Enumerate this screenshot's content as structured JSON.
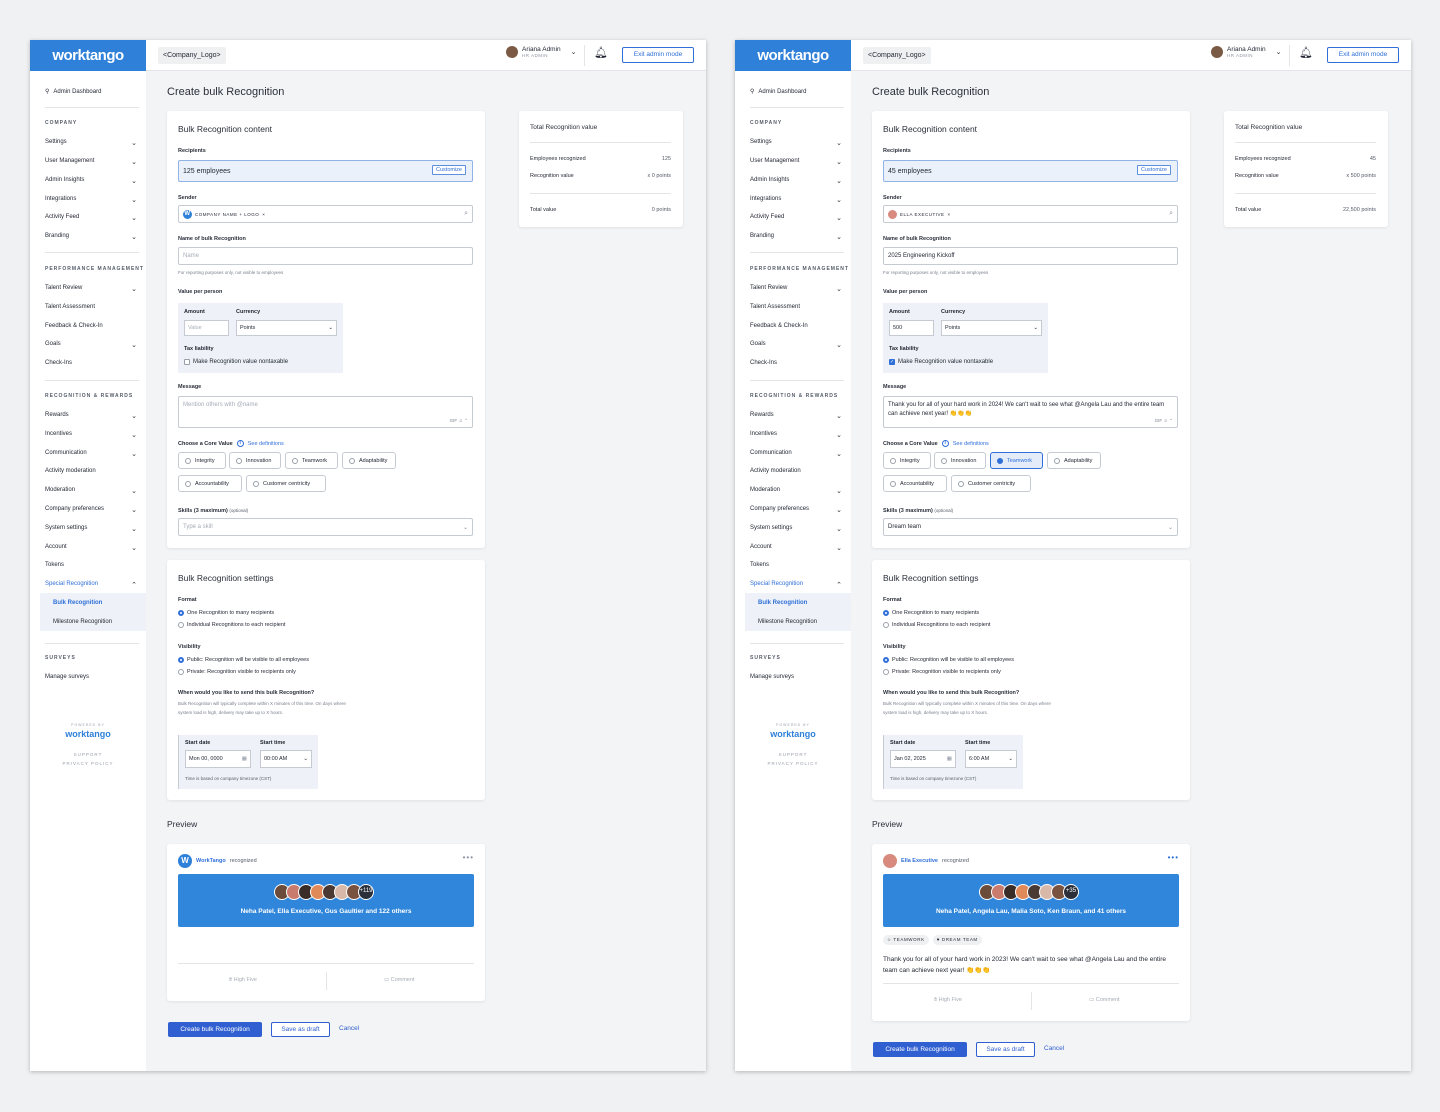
{
  "screens": [
    {
      "brand": "worktango",
      "company_logo": "<Company_Logo>",
      "user": {
        "name": "Ariana Admin",
        "role": "HR ADMIN"
      },
      "exit_admin": "Exit admin mode",
      "nav": {
        "dashboard": "Admin Dashboard",
        "company": "COMPANY",
        "settings": "Settings",
        "user_management": "User Management",
        "admin_insights": "Admin Insights",
        "integrations": "Integrations",
        "activity_feed": "Activity Feed",
        "branding": "Branding",
        "performance": "PERFORMANCE MANAGEMENT",
        "talent_review": "Talent Review",
        "talent_assessment": "Talent Assessment",
        "feedback": "Feedback & Check-In",
        "goals": "Goals",
        "checkins": "Check-Ins",
        "recognition": "RECOGNITION & REWARDS",
        "rewards": "Rewards",
        "incentives": "Incentives",
        "communication": "Communication",
        "activity_moderation": "Activity moderation",
        "moderation": "Moderation",
        "company_preferences": "Company preferences",
        "system_settings": "System settings",
        "account": "Account",
        "tokens": "Tokens",
        "special_recognition": "Special Recognition",
        "bulk_recognition": "Bulk Recognition",
        "milestone_recognition": "Milestone Recognition",
        "surveys": "SURVEYS",
        "manage_surveys": "Manage surveys",
        "powered_by": "POWERED BY",
        "footer_logo": "worktango",
        "support": "SUPPORT",
        "privacy": "PRIVACY POLICY"
      },
      "page_title": "Create bulk Recognition",
      "content": {
        "title": "Bulk Recognition content",
        "recipients_label": "Recipients",
        "recipients_value": "125 employees",
        "customize": "Customize",
        "sender_label": "Sender",
        "sender_chip": "COMPANY NAME + LOGO",
        "name_label": "Name of bulk Recognition",
        "name_value": "",
        "name_placeholder": "Name",
        "name_hint": "For reporting purposes only, not visible to employees",
        "vpp_label": "Value per person",
        "amount_label": "Amount",
        "amount_value": "",
        "amount_placeholder": "Value",
        "currency_label": "Currency",
        "currency_value": "Points",
        "tax_label": "Tax liability",
        "tax_checkbox": "Make Recognition value nontaxable",
        "tax_checked": false,
        "message_label": "Message",
        "message_value": "",
        "message_placeholder": "Mention others with @name",
        "msg_icons": "GIF ☺ ⌃",
        "core_value_label": "Choose a Core Value",
        "see_definitions": "See definitions",
        "core_values": [
          "Integrity",
          "Innovation",
          "Teamwork",
          "Adaptability",
          "Accountability",
          "Customer centricity"
        ],
        "selected_core_value": "",
        "skills_label": "Skills (3 maximum)",
        "skills_optional": "(optional)",
        "skills_value": "",
        "skills_placeholder": "Type a skill"
      },
      "settings": {
        "title": "Bulk Recognition settings",
        "format_label": "Format",
        "format_opt1": "One Recognition to many recipients",
        "format_opt2": "Individual Recognitions to each recipient",
        "visibility_label": "Visibility",
        "vis_opt1": "Public: Recognition will be visible to all employees",
        "vis_opt2": "Private: Recognition visible to recipients only",
        "when_label": "When would you like to send this bulk Recognition?",
        "when_desc": "Bulk Recognition will typically complete within X minutes of this time. On days where system load is high, delivery may take up to X hours.",
        "start_date_label": "Start date",
        "start_date_value": "Mon 00, 0000",
        "start_time_label": "Start time",
        "start_time_value": "00:00 AM",
        "tz_note": "Time is based on company timezone (CST)"
      },
      "preview": {
        "label": "Preview",
        "sender": "WorkTango",
        "recognized": "recognized",
        "more_count": "+119",
        "recipients_text": "Neha Patel, Ella Executive, Gus Gaultier and 122 others",
        "tags": [],
        "message": "",
        "high_five": "High Five",
        "comment": "Comment"
      },
      "total": {
        "title": "Total Recognition value",
        "employees_label": "Employees recognized",
        "employees_value": "125",
        "value_label": "Recognition value",
        "value_value": "x  0 points",
        "total_label": "Total value",
        "total_value": "0 points"
      },
      "actions": {
        "create": "Create bulk Recognition",
        "draft": "Save as draft",
        "cancel": "Cancel"
      }
    },
    {
      "brand": "worktango",
      "company_logo": "<Company_Logo>",
      "user": {
        "name": "Ariana Admin",
        "role": "HR ADMIN"
      },
      "exit_admin": "Exit admin mode",
      "nav": {
        "dashboard": "Admin Dashboard",
        "company": "COMPANY",
        "settings": "Settings",
        "user_management": "User Management",
        "admin_insights": "Admin Insights",
        "integrations": "Integrations",
        "activity_feed": "Activity Feed",
        "branding": "Branding",
        "performance": "PERFORMANCE MANAGEMENT",
        "talent_review": "Talent Review",
        "talent_assessment": "Talent Assessment",
        "feedback": "Feedback & Check-In",
        "goals": "Goals",
        "checkins": "Check-Ins",
        "recognition": "RECOGNITION & REWARDS",
        "rewards": "Rewards",
        "incentives": "Incentives",
        "communication": "Communication",
        "activity_moderation": "Activity moderation",
        "moderation": "Moderation",
        "company_preferences": "Company preferences",
        "system_settings": "System settings",
        "account": "Account",
        "tokens": "Tokens",
        "special_recognition": "Special Recognition",
        "bulk_recognition": "Bulk Recognition",
        "milestone_recognition": "Milestone Recognition",
        "surveys": "SURVEYS",
        "manage_surveys": "Manage surveys",
        "powered_by": "POWERED BY",
        "footer_logo": "worktango",
        "support": "SUPPORT",
        "privacy": "PRIVACY POLICY"
      },
      "page_title": "Create bulk Recognition",
      "content": {
        "title": "Bulk Recognition content",
        "recipients_label": "Recipients",
        "recipients_value": "45 employees",
        "customize": "Customize",
        "sender_label": "Sender",
        "sender_chip": "ELLA EXECUTIVE",
        "name_label": "Name of bulk Recognition",
        "name_value": "2025 Engineering Kickoff",
        "name_placeholder": "Name",
        "name_hint": "For reporting purposes only, not visible to employees",
        "vpp_label": "Value per person",
        "amount_label": "Amount",
        "amount_value": "500",
        "amount_placeholder": "Value",
        "currency_label": "Currency",
        "currency_value": "Points",
        "tax_label": "Tax liability",
        "tax_checkbox": "Make Recognition value nontaxable",
        "tax_checked": true,
        "message_label": "Message",
        "message_value": "Thank you for all of your hard work in 2024! We can't wait to see what @Angela Lau and the entire team can achieve next year! 👏👏👏",
        "message_placeholder": "Mention others with @name",
        "msg_icons": "GIF ☺ ⌃",
        "core_value_label": "Choose a Core Value",
        "see_definitions": "See definitions",
        "core_values": [
          "Integrity",
          "Innovation",
          "Teamwork",
          "Adaptability",
          "Accountability",
          "Customer centricity"
        ],
        "selected_core_value": "Teamwork",
        "skills_label": "Skills (3 maximum)",
        "skills_optional": "(optional)",
        "skills_value": "Dream team",
        "skills_placeholder": "Type a skill"
      },
      "settings": {
        "title": "Bulk Recognition settings",
        "format_label": "Format",
        "format_opt1": "One Recognition to many recipients",
        "format_opt2": "Individual Recognitions to each recipient",
        "visibility_label": "Visibility",
        "vis_opt1": "Public: Recognition will be visible to all employees",
        "vis_opt2": "Private: Recognition visible to recipients only",
        "when_label": "When would you like to send this bulk Recognition?",
        "when_desc": "Bulk Recognition will typically complete within X minutes of this time. On days where system load is high, delivery may take up to X hours.",
        "start_date_label": "Start date",
        "start_date_value": "Jan 02, 2025",
        "start_time_label": "Start time",
        "start_time_value": "6:00 AM",
        "tz_note": "Time is based on company timezone (CST)"
      },
      "preview": {
        "label": "Preview",
        "sender": "Ella Executive",
        "recognized": "recognized",
        "more_count": "+35",
        "recipients_text": "Neha Patel, Angela Lau, Malia Soto, Ken Braun, and 41 others",
        "tags": [
          "TEAMWORK",
          "DREAM TEAM"
        ],
        "message": "Thank you for all of your hard work in 2023! We can't wait to see what @Angela Lau and the entire team can achieve next year! 👏👏👏",
        "high_five": "High Five",
        "comment": "Comment"
      },
      "total": {
        "title": "Total Recognition value",
        "employees_label": "Employees recognized",
        "employees_value": "45",
        "value_label": "Recognition value",
        "value_value": "x  500 points",
        "total_label": "Total value",
        "total_value": "22,500 points"
      },
      "actions": {
        "create": "Create bulk Recognition",
        "draft": "Save as draft",
        "cancel": "Cancel"
      }
    }
  ]
}
